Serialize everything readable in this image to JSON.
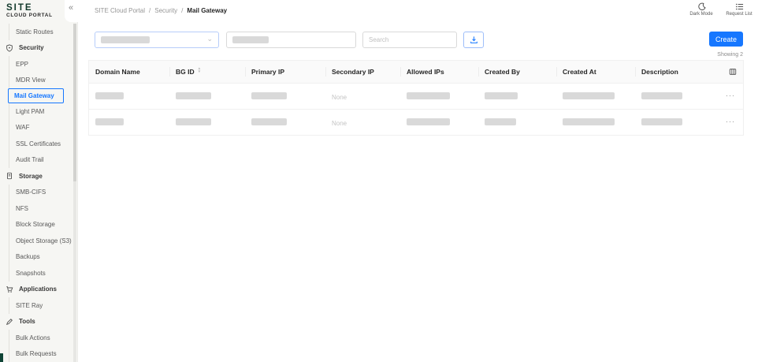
{
  "brand": {
    "title": "SITE",
    "subtitle": "CLOUD PORTAL"
  },
  "topbar": {
    "collapse_icon": "«",
    "breadcrumb": {
      "items": [
        "SITE Cloud Portal",
        "Security",
        "Mail Gateway"
      ],
      "separator": "/"
    },
    "actions": [
      {
        "label": "Dark Mode",
        "icon": "moon-icon"
      },
      {
        "label": "Request List",
        "icon": "request-list-icon"
      }
    ]
  },
  "sidebar": {
    "items": [
      {
        "label": "Static Routes",
        "type": "link"
      },
      {
        "label": "Security",
        "type": "section",
        "icon": "shield-icon"
      },
      {
        "label": "EPP",
        "type": "link"
      },
      {
        "label": "MDR View",
        "type": "link"
      },
      {
        "label": "Mail Gateway",
        "type": "link",
        "selected": true
      },
      {
        "label": "Light PAM",
        "type": "link"
      },
      {
        "label": "WAF",
        "type": "link"
      },
      {
        "label": "SSL Certificates",
        "type": "link"
      },
      {
        "label": "Audit Trail",
        "type": "link"
      },
      {
        "label": "Storage",
        "type": "section",
        "icon": "database-icon"
      },
      {
        "label": "SMB-CIFS",
        "type": "link"
      },
      {
        "label": "NFS",
        "type": "link"
      },
      {
        "label": "Block Storage",
        "type": "link"
      },
      {
        "label": "Object Storage (S3)",
        "type": "link"
      },
      {
        "label": "Backups",
        "type": "link"
      },
      {
        "label": "Snapshots",
        "type": "link"
      },
      {
        "label": "Applications",
        "type": "section",
        "icon": "cart-icon"
      },
      {
        "label": "SITE Ray",
        "type": "link"
      },
      {
        "label": "Tools",
        "type": "section",
        "icon": "pen-icon"
      },
      {
        "label": "Bulk Actions",
        "type": "link"
      },
      {
        "label": "Bulk Requests",
        "type": "link",
        "clipped": true
      }
    ]
  },
  "toolbar": {
    "search_placeholder": "Search",
    "create_label": "Create",
    "showing_label": "Showing 2",
    "download_icon": "download-icon"
  },
  "table": {
    "columns": [
      "Domain Name",
      "BG ID",
      "Primary IP",
      "Secondary IP",
      "Allowed IPs",
      "Created By",
      "Created At",
      "Description"
    ],
    "rows": [
      {
        "secondary_ip": "None"
      },
      {
        "secondary_ip": "None"
      }
    ]
  },
  "icons": {
    "more": "···",
    "chevron_down": "⌄",
    "sort_up": "▴",
    "sort_down": "▾"
  },
  "colors": {
    "accent": "#1677ff",
    "brand_green": "#12392b"
  }
}
